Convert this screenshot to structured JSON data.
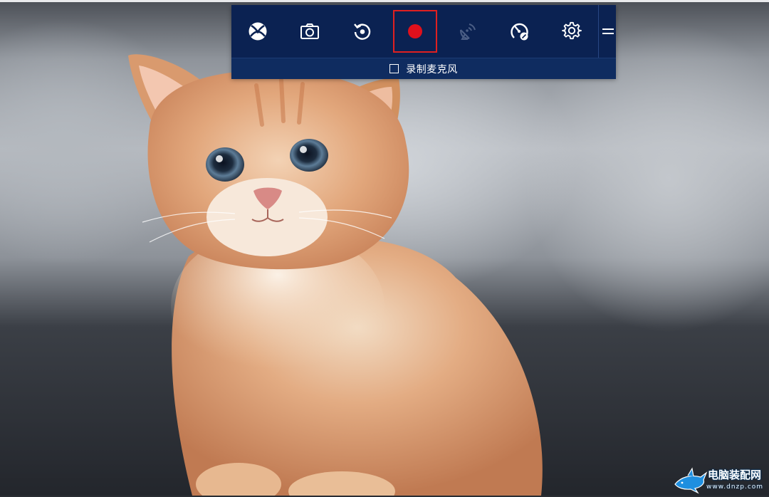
{
  "game_bar": {
    "buttons": [
      {
        "name": "xbox-icon",
        "label": "Xbox"
      },
      {
        "name": "camera-icon",
        "label": "Screenshot"
      },
      {
        "name": "replay-icon",
        "label": "Record that"
      },
      {
        "name": "record-icon",
        "label": "Start recording"
      },
      {
        "name": "broadcast-icon",
        "label": "Broadcast"
      },
      {
        "name": "performance-gauge-icon",
        "label": "Performance"
      },
      {
        "name": "gear-icon",
        "label": "Settings"
      },
      {
        "name": "grip-icon",
        "label": "Move"
      }
    ],
    "record_microphone_label": "录制麦克风",
    "record_microphone_checked": false,
    "colors": {
      "bar_bg": "#0b2252",
      "record_dot": "#e0101c",
      "highlight_border": "#e02020"
    }
  },
  "background": {
    "subject": "kitten-photo"
  },
  "watermark": {
    "title": "电脑装配网",
    "url": "www.dnzp.com"
  }
}
